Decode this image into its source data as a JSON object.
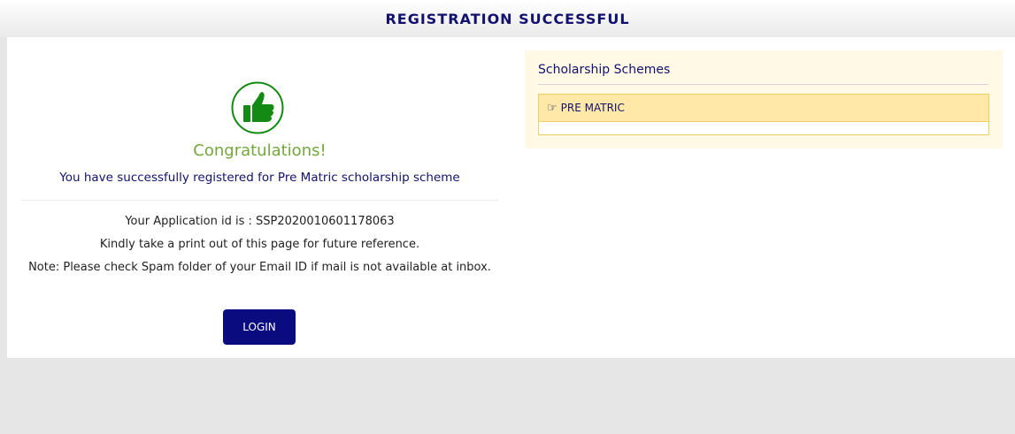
{
  "header": {
    "title": "REGISTRATION SUCCESSFUL"
  },
  "main": {
    "congrats": "Congratulations!",
    "success_message": "You have successfully registered for Pre Matric scholarship scheme",
    "application_id_line": "Your Application id is : SSP2020010601178063",
    "print_note": "Kindly take a print out of this page for future reference.",
    "spam_note": "Note: Please check Spam folder of your Email ID if mail is not available at inbox.",
    "login_label": "LOGIN"
  },
  "sidebar": {
    "title": "Scholarship Schemes",
    "items": [
      {
        "icon": "hand-pointing-right-icon",
        "label": "PRE MATRIC"
      }
    ]
  },
  "colors": {
    "header_text": "#12126e",
    "congrats": "#72a83a",
    "thumb": "#138a13",
    "login_button": "#0b0b80",
    "scheme_item_bg": "#ffe8a8"
  }
}
